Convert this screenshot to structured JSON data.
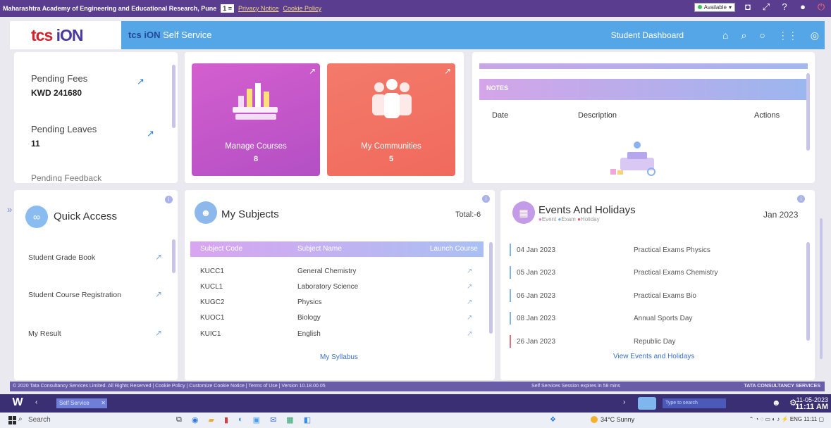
{
  "topbar": {
    "org": "Maharashtra Academy of Engineering and Educational Research, Pune",
    "user_chip": "1 =",
    "privacy": "Privacy Notice",
    "cookie": "Cookie Policy",
    "availability": "Available"
  },
  "header": {
    "logo_tcs": "tcs",
    "logo_ion": "iON",
    "app_prefix": "tcs iON",
    "app_name": "Self Service",
    "dashboard": "Student Dashboard"
  },
  "pending": {
    "fees_label": "Pending Fees",
    "fees_value": "KWD 241680",
    "leaves_label": "Pending Leaves",
    "leaves_value": "11",
    "feedback_label": "Pending Feedback"
  },
  "tiles": {
    "courses_label": "Manage Courses",
    "courses_value": "8",
    "communities_label": "My Communities",
    "communities_value": "5"
  },
  "notes": {
    "title": "NOTES",
    "col_date": "Date",
    "col_desc": "Description",
    "col_actions": "Actions"
  },
  "quick_access": {
    "title": "Quick Access",
    "items": [
      "Student Grade Book",
      "Student Course Registration",
      "My Result"
    ]
  },
  "subjects": {
    "title": "My Subjects",
    "total": "Total:-6",
    "col_code": "Subject Code",
    "col_name": "Subject Name",
    "col_launch": "Launch Course",
    "rows": [
      {
        "code": "KUCC1",
        "name": "General Chemistry"
      },
      {
        "code": "KUCL1",
        "name": "Laboratory Science"
      },
      {
        "code": "KUGC2",
        "name": "Physics"
      },
      {
        "code": "KUOC1",
        "name": "Biology"
      },
      {
        "code": "KUIC1",
        "name": "English"
      }
    ],
    "syllabus_link": "My Syllabus"
  },
  "events": {
    "title": "Events And Holidays",
    "legend_event": "Event",
    "legend_exam": "Exam",
    "legend_holiday": "Holiday",
    "month": "Jan 2023",
    "rows": [
      {
        "date": "04 Jan 2023",
        "name": "Practical Exams Physics",
        "color": "#7fb4e8"
      },
      {
        "date": "05 Jan 2023",
        "name": "Practical Exams Chemistry",
        "color": "#7fb4e8"
      },
      {
        "date": "06 Jan 2023",
        "name": "Practical Exams Bio",
        "color": "#7fb4e8"
      },
      {
        "date": "08 Jan 2023",
        "name": "Annual Sports Day",
        "color": "#7fb4e8"
      },
      {
        "date": "26 Jan 2023",
        "name": "Republic Day",
        "color": "#e0707a"
      }
    ],
    "view_link": "View Events and Holidays"
  },
  "footer": {
    "left": "© 2020 Tata Consultancy Services Limited. All Rights Reserved | Cookie Policy | Customize Cookie Notice | Terms of Use | Version 10.18.00.05",
    "mid": "Self Services Session expires in 58 mins",
    "right": "TATA CONSULTANCY SERVICES"
  },
  "taskbar": {
    "tab": "Self Service",
    "search_placeholder": "Type to search",
    "date": "11-05-2023",
    "time": "11:11 AM",
    "win_search": "Search",
    "weather": "34°C Sunny",
    "tray": "ENG 11:11"
  }
}
